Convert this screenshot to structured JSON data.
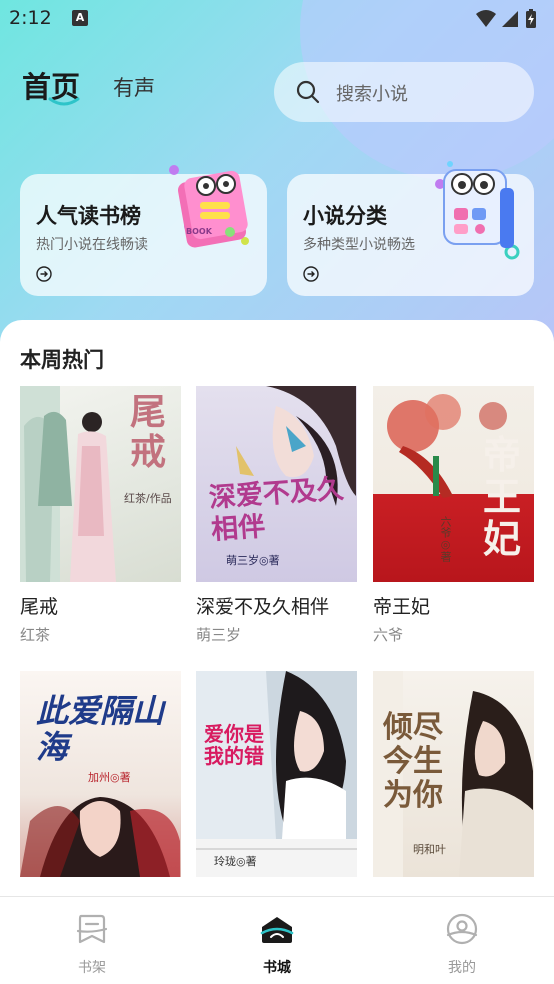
{
  "status_bar": {
    "time": "2:12",
    "notification_badge": "A"
  },
  "header": {
    "tabs": [
      {
        "label": "首页",
        "active": true
      },
      {
        "label": "有声",
        "active": false
      }
    ],
    "search": {
      "placeholder": "搜索小说"
    }
  },
  "cards": [
    {
      "title": "人气读书榜",
      "subtitle": "热门小说在线畅读",
      "art_text": "BOOK"
    },
    {
      "title": "小说分类",
      "subtitle": "多种类型小说畅选"
    }
  ],
  "section": {
    "title": "本周热门"
  },
  "books": [
    {
      "title": "尾戒",
      "author": "红茶",
      "cover_title": "尾戒",
      "cover_author": "红茶/作品",
      "cover_colors": [
        "#eef0ea",
        "#c98d97"
      ]
    },
    {
      "title": "深爱不及久相伴",
      "author": "萌三岁",
      "cover_title": "深爱不及久相伴",
      "cover_author": "萌三岁◎著",
      "cover_colors": [
        "#d9d4ea",
        "#b13a8e"
      ]
    },
    {
      "title": "帝王妃",
      "author": "六爷",
      "cover_title": "帝王妃",
      "cover_author": "六爷◎著",
      "cover_colors": [
        "#f3efe8",
        "#c91f24"
      ]
    },
    {
      "title": "",
      "author": "",
      "cover_title": "此爱隔山海",
      "cover_author": "加州◎著",
      "cover_colors": [
        "#f7f2ee",
        "#c2185b"
      ]
    },
    {
      "title": "",
      "author": "",
      "cover_title": "爱你是我的错",
      "cover_author": "玲珑◎著",
      "cover_colors": [
        "#e8eef4",
        "#d81b60"
      ]
    },
    {
      "title": "",
      "author": "",
      "cover_title": "倾尽今生为你",
      "cover_author": "明和叶",
      "cover_colors": [
        "#f1ece4",
        "#7a5a3a"
      ]
    }
  ],
  "bottom_nav": [
    {
      "label": "书架",
      "icon": "bookshelf-icon",
      "active": false
    },
    {
      "label": "书城",
      "icon": "bookstore-icon",
      "active": true
    },
    {
      "label": "我的",
      "icon": "profile-icon",
      "active": false
    }
  ],
  "colors": {
    "accent": "#2ec4c9",
    "gradient_start": "#6fe6e0",
    "gradient_end": "#b9c4f8"
  }
}
